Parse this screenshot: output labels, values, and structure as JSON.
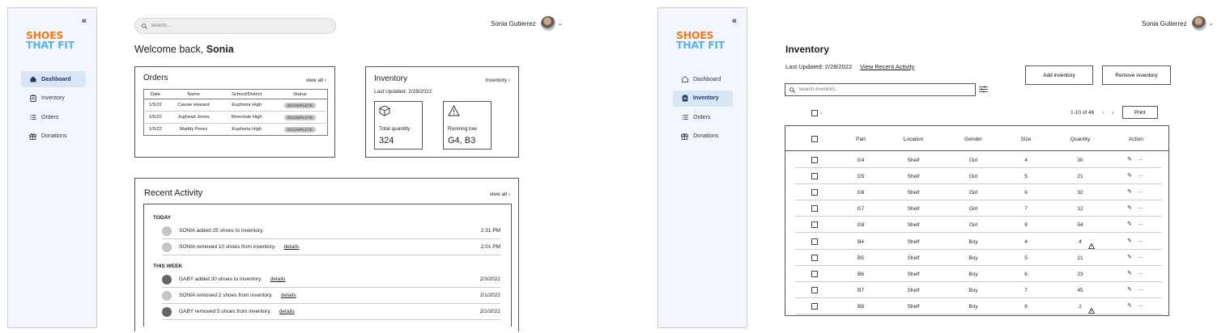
{
  "brand": {
    "line1": "SHOES",
    "line2": "THAT FIT"
  },
  "sidebar": {
    "collapse": "«",
    "items": [
      {
        "label": "Dashboard",
        "icon": "home-icon"
      },
      {
        "label": "Inventory",
        "icon": "clipboard-icon"
      },
      {
        "label": "Orders",
        "icon": "list-icon"
      },
      {
        "label": "Donations",
        "icon": "gift-icon"
      }
    ]
  },
  "user": {
    "name": "Sonia Gutierrez"
  },
  "dashboard": {
    "search_placeholder": "Search...",
    "welcome_prefix": "Welcome back, ",
    "welcome_name": "Sonia",
    "orders": {
      "title": "Orders",
      "view_all": "view all  ›",
      "columns": [
        "Date",
        "Name",
        "School/District",
        "Status"
      ],
      "rows": [
        {
          "date": "1/5/22",
          "name": "Cassie Howard",
          "school": "Euphoria High",
          "status": "INCOMPLETE"
        },
        {
          "date": "1/5/22",
          "name": "Jughead Jones",
          "school": "Riverdale High",
          "status": "INCOMPLETE"
        },
        {
          "date": "1/5/22",
          "name": "Maddy Perez",
          "school": "Euphoria High",
          "status": "INCOMPLETE"
        }
      ]
    },
    "inventory": {
      "title": "Inventory",
      "link": "Inventory  ›",
      "updated": "Last Updated: 2/28/2022",
      "total_label": "Total quantity",
      "total_value": "324",
      "low_label": "Running low",
      "low_value": "G4, B3"
    },
    "activity": {
      "title": "Recent Activity",
      "view_all": "view all  ›",
      "today_label": "TODAY",
      "week_label": "THIS WEEK",
      "details_label": "details",
      "today": [
        {
          "text": "SONIA added 25 shoes to inventory.",
          "time": "2:31 PM",
          "dot": "#c4c4c4"
        },
        {
          "text": "SONIA removed 10 shoes from inventory.",
          "time": "2:01 PM",
          "dot": "#c4c4c4"
        }
      ],
      "week": [
        {
          "text": "GABY added 30 shoes to inventory.",
          "time": "2/3/2022",
          "dot": "#6b6466"
        },
        {
          "text": "SONIA removed 2 shoes from inventory.",
          "time": "2/1/2022",
          "dot": "#c4c4c4"
        },
        {
          "text": "GABY removed 5 shoes from inventory.",
          "time": "2/1/2022",
          "dot": "#6b6466"
        }
      ]
    }
  },
  "inventory_page": {
    "title": "Inventory",
    "updated": "Last Updated: 2/28/2022",
    "recent_link": "View Recent Activity",
    "add_button": "Add inventory",
    "remove_button": "Remove inventory",
    "search_placeholder": "Search inventory...",
    "pagination": "1-10 of 46",
    "print_button": "Print",
    "columns": [
      "Part",
      "Location",
      "Gender",
      "Size",
      "Quantity",
      "Action"
    ],
    "rows": [
      {
        "part": "G4",
        "location": "Shelf",
        "gender": "Girl",
        "size": "4",
        "quantity": "30",
        "low": false
      },
      {
        "part": "G5",
        "location": "Shelf",
        "gender": "Girl",
        "size": "5",
        "quantity": "21",
        "low": false
      },
      {
        "part": "G6",
        "location": "Shelf",
        "gender": "Girl",
        "size": "6",
        "quantity": "32",
        "low": false
      },
      {
        "part": "G7",
        "location": "Shelf",
        "gender": "Girl",
        "size": "7",
        "quantity": "12",
        "low": false
      },
      {
        "part": "G8",
        "location": "Shelf",
        "gender": "Girl",
        "size": "8",
        "quantity": "54",
        "low": false
      },
      {
        "part": "B4",
        "location": "Shelf",
        "gender": "Boy",
        "size": "4",
        "quantity": "4",
        "low": true
      },
      {
        "part": "B5",
        "location": "Shelf",
        "gender": "Boy",
        "size": "5",
        "quantity": "21",
        "low": false
      },
      {
        "part": "B6",
        "location": "Shelf",
        "gender": "Boy",
        "size": "6",
        "quantity": "23",
        "low": false
      },
      {
        "part": "B7",
        "location": "Shelf",
        "gender": "Boy",
        "size": "7",
        "quantity": "45",
        "low": false
      },
      {
        "part": "B8",
        "location": "Shelf",
        "gender": "Boy",
        "size": "8",
        "quantity": "2",
        "low": true
      }
    ]
  }
}
